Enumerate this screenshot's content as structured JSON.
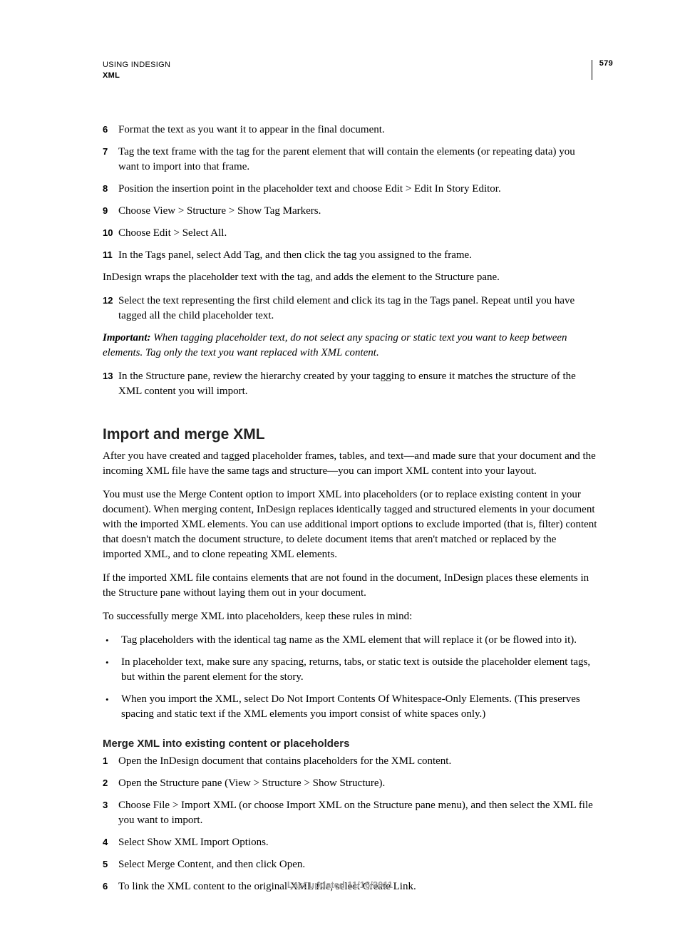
{
  "header": {
    "title": "USING INDESIGN",
    "section": "XML",
    "page_number": "579"
  },
  "steps_a": [
    {
      "n": "6",
      "t": "Format the text as you want it to appear in the final document."
    },
    {
      "n": "7",
      "t": "Tag the text frame with the tag for the parent element that will contain the elements (or repeating data) you want to import into that frame."
    },
    {
      "n": "8",
      "t": "Position the insertion point in the placeholder text and choose Edit > Edit In Story Editor."
    },
    {
      "n": "9",
      "t": "Choose View > Structure > Show Tag Markers."
    },
    {
      "n": "10",
      "t": "Choose Edit > Select All."
    },
    {
      "n": "11",
      "t": "In the Tags panel, select Add Tag, and then click the tag you assigned to the frame."
    }
  ],
  "para_wrap": "InDesign wraps the placeholder text with the tag, and adds the element to the Structure pane.",
  "steps_b": [
    {
      "n": "12",
      "t": "Select the text representing the first child element and click its tag in the Tags panel. Repeat until you have tagged all the child placeholder text."
    }
  ],
  "note": {
    "label": "Important:",
    "text": " When tagging placeholder text, do not select any spacing or static text you want to keep between elements. Tag only the text you want replaced with XML content."
  },
  "steps_c": [
    {
      "n": "13",
      "t": "In the Structure pane, review the hierarchy created by your tagging to ensure it matches the structure of the XML content you will import."
    }
  ],
  "h2": "Import and merge XML",
  "p1": "After you have created and tagged placeholder frames, tables, and text—and made sure that your document and the incoming XML file have the same tags and structure—you can import XML content into your layout.",
  "p2": "You must use the Merge Content option to import XML into placeholders (or to replace existing content in your document). When merging content, InDesign replaces identically tagged and structured elements in your document with the imported XML elements. You can use additional import options to exclude imported (that is, filter) content that doesn't match the document structure, to delete document items that aren't matched or replaced by the imported XML, and to clone repeating XML elements.",
  "p3": "If the imported XML file contains elements that are not found in the document, InDesign places these elements in the Structure pane without laying them out in your document.",
  "p4": "To successfully merge XML into placeholders, keep these rules in mind:",
  "bullets": [
    "Tag placeholders with the identical tag name as the XML element that will replace it (or be flowed into it).",
    "In placeholder text, make sure any spacing, returns, tabs, or static text is outside the placeholder element tags, but within the parent element for the story.",
    "When you import the XML, select Do Not Import Contents Of Whitespace-Only Elements. (This preserves spacing and static text if the XML elements you import consist of white spaces only.)"
  ],
  "h3": "Merge XML into existing content or placeholders",
  "steps_d": [
    {
      "n": "1",
      "t": "Open the InDesign document that contains placeholders for the XML content."
    },
    {
      "n": "2",
      "t": "Open the Structure pane (View > Structure > Show Structure)."
    },
    {
      "n": "3",
      "t": "Choose File > Import XML (or choose Import XML on the Structure pane menu), and then select the XML file you want to import."
    },
    {
      "n": "4",
      "t": "Select Show XML Import Options."
    },
    {
      "n": "5",
      "t": "Select Merge Content, and then click Open."
    },
    {
      "n": "6",
      "t": "To link the XML content to the original XML file, select Create Link."
    }
  ],
  "footer": "Last updated 11/16/2011"
}
